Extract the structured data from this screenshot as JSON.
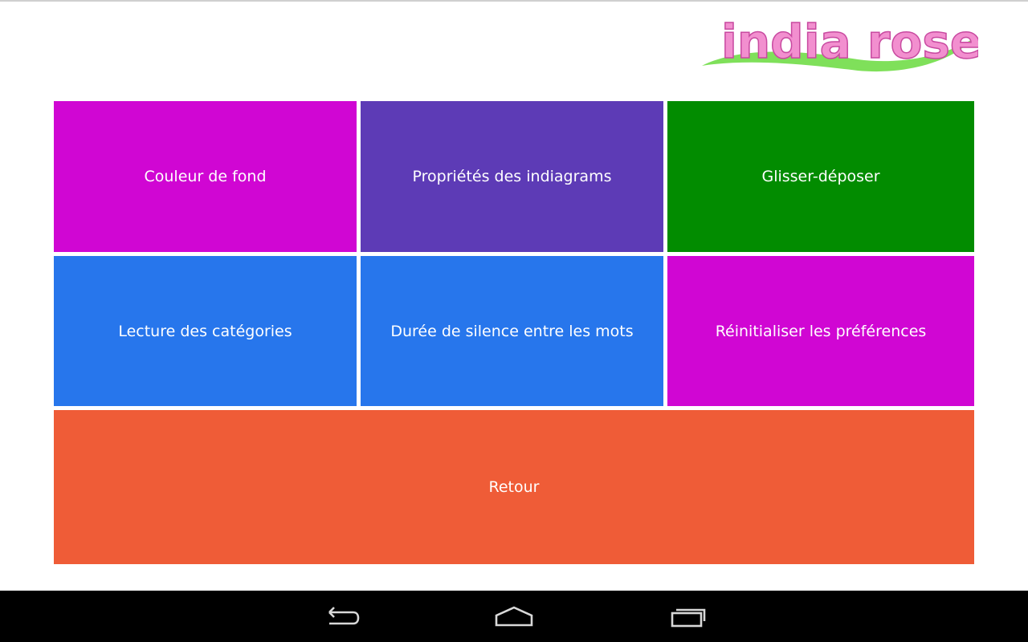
{
  "logo": {
    "text": "india rose",
    "text_color": "#f28fcf",
    "swoosh_color": "#7fe05a"
  },
  "tiles": [
    {
      "label": "Couleur de fond",
      "color": "#d006d3"
    },
    {
      "label": "Propriétés des indiagrams",
      "color": "#5d3bb6"
    },
    {
      "label": "Glisser-déposer",
      "color": "#028c00"
    },
    {
      "label": "Lecture des catégories",
      "color": "#2776ec"
    },
    {
      "label": "Durée de silence entre les mots",
      "color": "#2776ec"
    },
    {
      "label": "Réinitialiser les préférences",
      "color": "#d006d3"
    }
  ],
  "back_button": {
    "label": "Retour",
    "color": "#ef5c37"
  },
  "navbar": {
    "back_icon": "back-arrow-icon",
    "home_icon": "home-icon",
    "recents_icon": "recent-apps-icon"
  }
}
